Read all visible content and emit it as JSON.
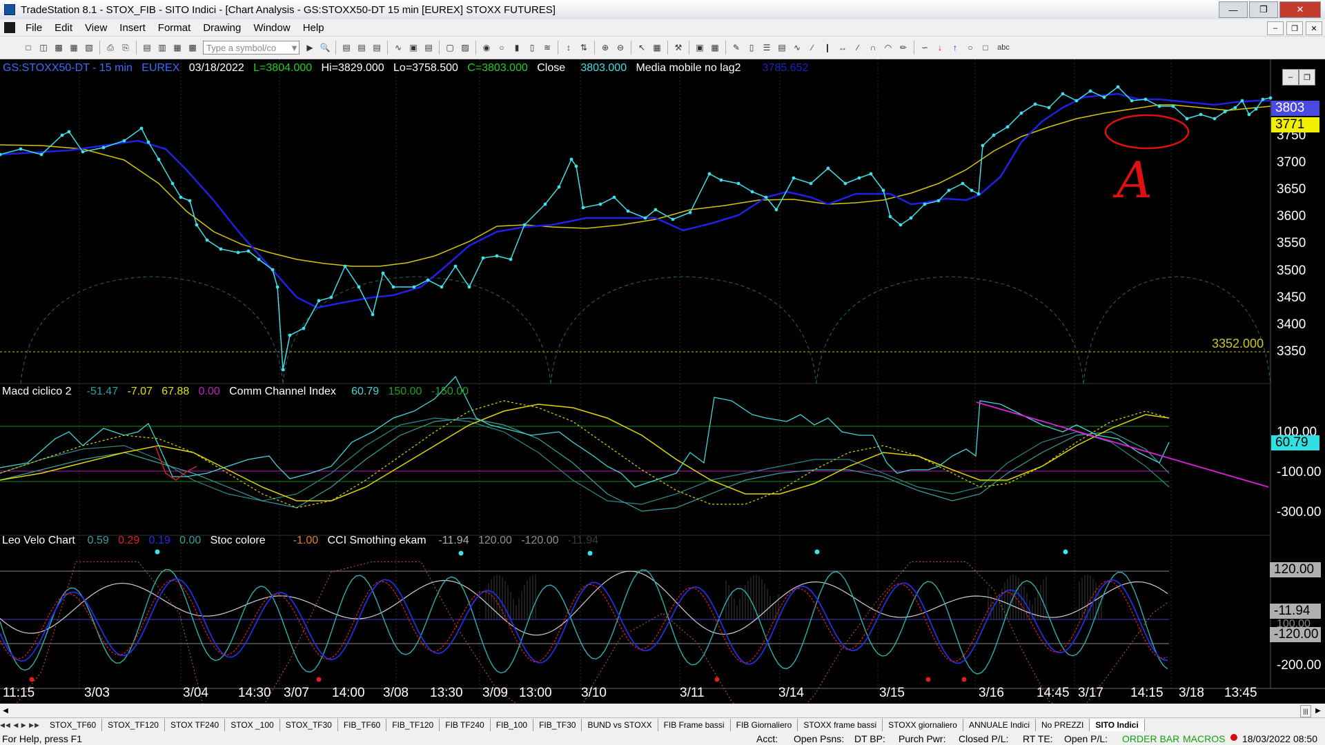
{
  "window": {
    "title": "TradeStation 8.1 - STOX_FIB - SITO Indici - [Chart Analysis - GS:STOXX50-DT  15 min  [EUREX] STOXX FUTURES]"
  },
  "menu": [
    "File",
    "Edit",
    "View",
    "Insert",
    "Format",
    "Drawing",
    "Window",
    "Help"
  ],
  "toolbar": {
    "symbol_placeholder": "Type a symbol/co",
    "abc": "abc"
  },
  "price_panel": {
    "symbol": "GS:STOXX50-DT - 15 min",
    "exchange": "EUREX",
    "date": "03/18/2022",
    "last": "L=3804.000",
    "high": "Hi=3829.000",
    "low": "Lo=3758.500",
    "close_val": "C=3803.000",
    "close_label": "Close",
    "close_num": "3803.000",
    "ma_label": "Media mobile no lag2",
    "ma_val": "3785.652",
    "axis": [
      "3750",
      "3700",
      "3650",
      "3600",
      "3550",
      "3500",
      "3450",
      "3400",
      "3350"
    ],
    "box_last": "3803",
    "box_ma": "3771",
    "level_line": "3352.000",
    "annotation": "A"
  },
  "macd_panel": {
    "label": "Macd ciclico 2",
    "v1": "-51.47",
    "v2": "-7.07",
    "v3": "67.88",
    "v4": "0.00",
    "cci_label": "Comm Channel Index",
    "cci_val": "60.79",
    "upper": "150.00",
    "lower": "-150.00",
    "axis": [
      "100.00",
      "-100.00",
      "-300.00"
    ],
    "box_cci": "60.79"
  },
  "leo_panel": {
    "label": "Leo Velo Chart",
    "v1": "0.59",
    "v2": "0.29",
    "v3": "0.19",
    "v4": "0.00",
    "stoc_label": "Stoc colore",
    "stoc_val": "-1.00",
    "cci_label": "CCI Smothing ekam",
    "cci_val": "-11.94",
    "upper": "120.00",
    "lower": "-120.00",
    "extra": "-11.94",
    "axis_top": "120.00",
    "axis_mid": "-11.94",
    "axis_hidden": "100.00",
    "axis_low": "-120.00",
    "axis_bottom": "-200.00"
  },
  "time_axis": [
    "11:15",
    "3/03",
    "3/04",
    "14:30",
    "3/07",
    "14:00",
    "3/08",
    "13:30",
    "3/09",
    "13:00",
    "3/10",
    "3/11",
    "3/14",
    "3/15",
    "3/16",
    "14:45",
    "3/17",
    "14:15",
    "3/18",
    "13:45"
  ],
  "tabs": [
    "STOX_TF60",
    "STOX_TF120",
    "STOX TF240",
    "STOX _100",
    "STOX_TF30",
    "FIB_TF60",
    "FIB_TF120",
    "FIB TF240",
    "FIB_100",
    "FIB_TF30",
    "BUND vs STOXX",
    "FIB Frame bassi",
    "FIB Giornaliero",
    "STOXX frame bassi",
    "STOXX giornaliero",
    "ANNUALE Indici",
    "No PREZZI",
    "SITO Indici"
  ],
  "status": {
    "help": "For Help, press F1",
    "acct": "Acct:",
    "open_psns": "Open Psns:",
    "dt_bp": "DT BP:",
    "purch_pwr": "Purch Pwr:",
    "closed_pl": "Closed P/L:",
    "rt_te": "RT TE:",
    "open_pl": "Open P/L:",
    "order_bar": "ORDER BAR",
    "macros": "MACROS",
    "datetime": "18/03/2022 08:50"
  },
  "colors": {
    "bg": "#000000",
    "cyan": "#40e0e8",
    "blue": "#2020e0",
    "yellow": "#e0e000",
    "red": "#e02020",
    "magenta": "#e020e0",
    "green": "#20c020"
  }
}
